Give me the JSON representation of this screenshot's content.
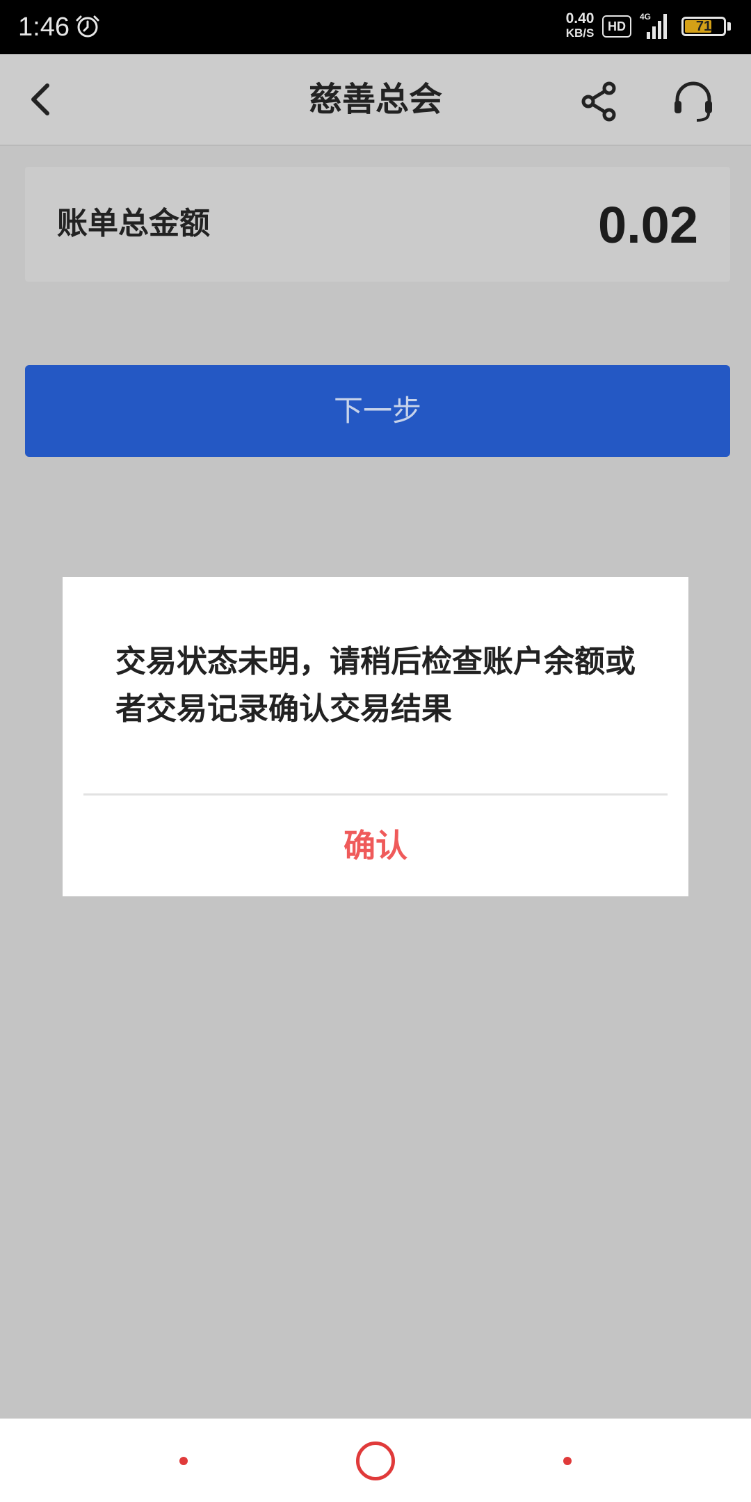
{
  "status_bar": {
    "time": "1:46",
    "alarm_icon": "alarm-clock-icon",
    "net_speed_value": "0.40",
    "net_speed_unit": "KB/S",
    "hd_label": "HD",
    "network_label": "4G",
    "battery_level": "71",
    "battery_fraction": 0.71,
    "battery_color": "#d4a017"
  },
  "header": {
    "title": "慈善总会",
    "back_icon": "chevron-left-icon",
    "share_icon": "share-icon",
    "support_icon": "headset-icon"
  },
  "amount": {
    "label": "账单总金额",
    "value": "0.02"
  },
  "next_button": {
    "label": "下一步",
    "color": "#2458c4"
  },
  "dialog": {
    "message": "交易状态未明，请稍后检查账户余额或者交易记录确认交易结果",
    "confirm_label": "确认",
    "confirm_color": "#ef5a5a"
  },
  "nav_bar": {
    "accent_color": "#e03a3a",
    "items": [
      "menu-dot",
      "home-circle",
      "back-dot"
    ]
  }
}
